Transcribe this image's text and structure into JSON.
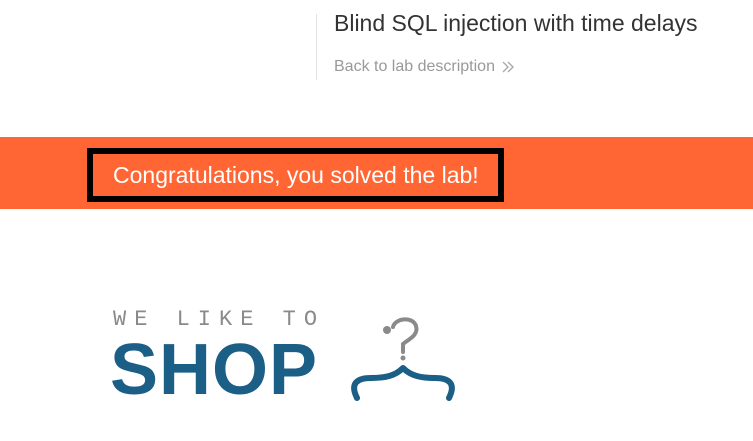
{
  "lab": {
    "title": "Blind SQL injection with time delays",
    "back_link": "Back to lab description"
  },
  "banner": {
    "message": "Congratulations, you solved the lab!",
    "color": "#ff6633"
  },
  "logo": {
    "tagline": "WE LIKE TO",
    "name": "SHOP",
    "brand_color": "#1b5e86",
    "icon": "hanger-icon"
  }
}
